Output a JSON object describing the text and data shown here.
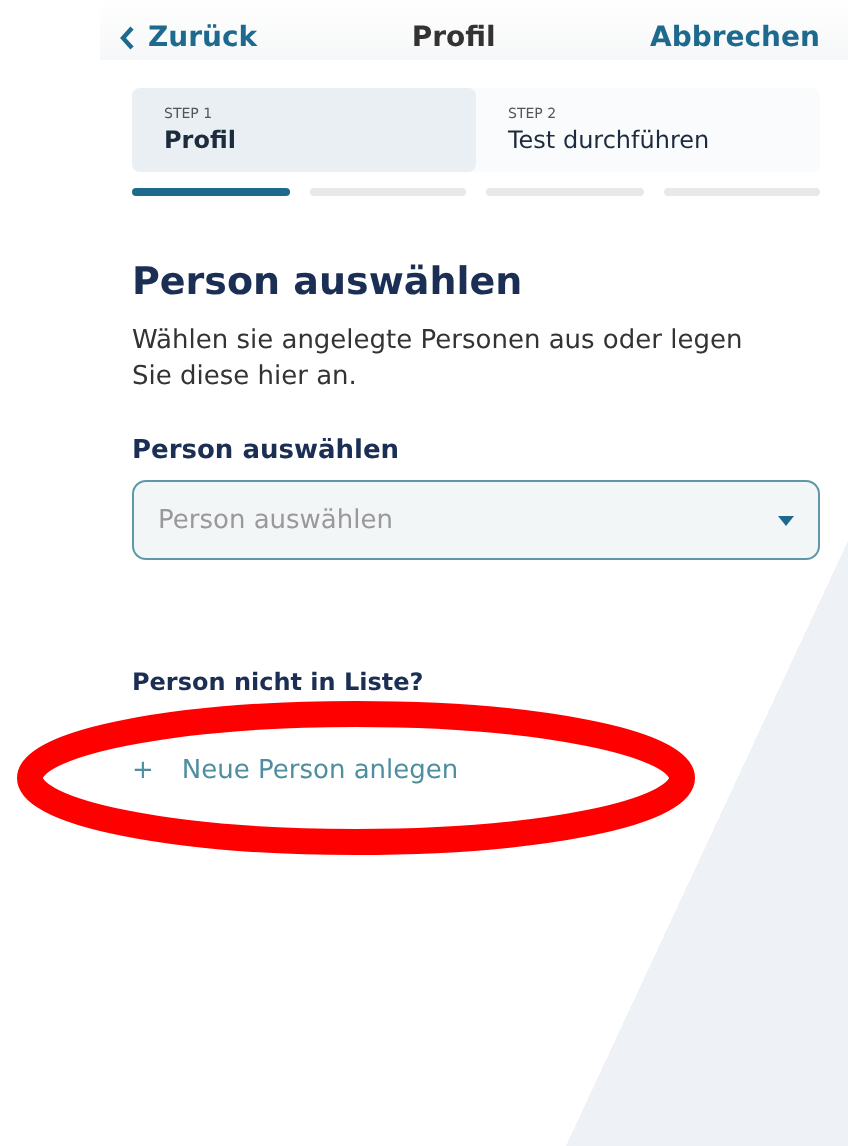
{
  "header": {
    "back_label": "Zurück",
    "title": "Profil",
    "cancel_label": "Abbrechen"
  },
  "steps": [
    {
      "step": "STEP 1",
      "label": "Profil",
      "selected": true
    },
    {
      "step": "STEP 2",
      "label": "Test durchführen",
      "selected": false
    }
  ],
  "progress_segments": [
    {
      "selected": true
    },
    {
      "selected": false
    },
    {
      "selected": false
    },
    {
      "selected": false
    }
  ],
  "heading": "Person auswählen",
  "description": "Wählen sie angelegte Personen aus oder legen Sie diese hier an.",
  "person_select": {
    "label": "Person auswählen",
    "placeholder": "Person auswählen"
  },
  "not_in_list": {
    "question": "Person nicht in Liste?",
    "link_icon": "+",
    "link_label": "Neue Person anlegen"
  },
  "annotation": {
    "kind": "ellipse",
    "color": "#ff0000"
  }
}
